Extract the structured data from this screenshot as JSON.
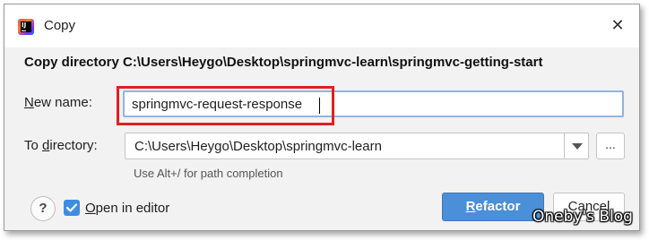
{
  "window": {
    "title": "Copy",
    "app_icon": "intellij-idea-icon",
    "close_glyph": "✕"
  },
  "header": {
    "text": "Copy directory C:\\Users\\Heygo\\Desktop\\springmvc-learn\\springmvc-getting-start"
  },
  "new_name": {
    "label_mnemonic": "N",
    "label_rest": "ew name:",
    "value": "springmvc-request-response"
  },
  "to_directory": {
    "label_before": "To ",
    "label_mnemonic": "d",
    "label_rest": "irectory:",
    "value": "C:\\Users\\Heygo\\Desktop\\springmvc-learn",
    "browse_label": "..."
  },
  "hint": "Use Alt+/ for path completion",
  "footer": {
    "help_label": "?",
    "open_in_editor": {
      "checked": true,
      "label_mnemonic": "O",
      "label_rest": "pen in editor"
    },
    "refactor_mnemonic": "R",
    "refactor_rest": "efactor",
    "cancel_label": "Cancel"
  },
  "watermark": "Oneby's Blog",
  "colors": {
    "accent": "#4a8fd8",
    "highlight_box": "#e02020",
    "focus_border": "#8fb4e6"
  }
}
